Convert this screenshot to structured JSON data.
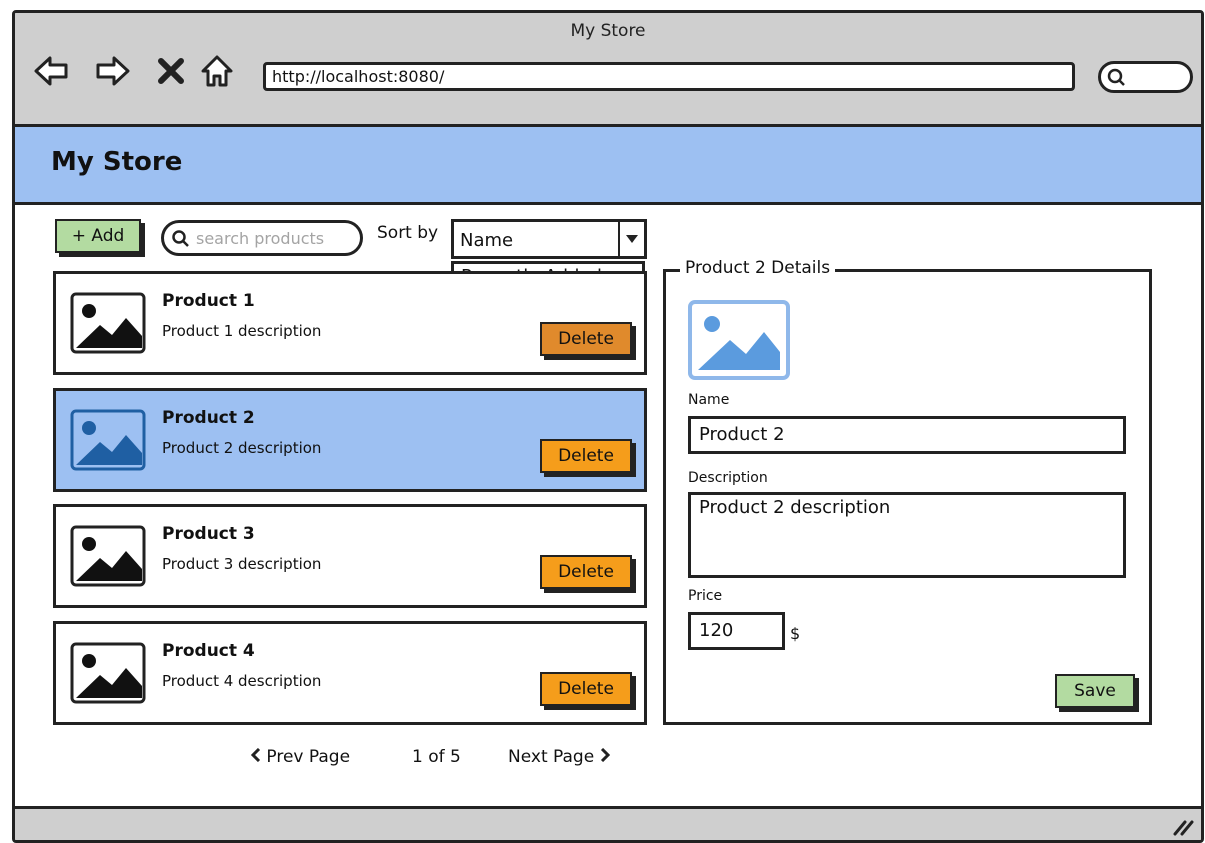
{
  "browser": {
    "title": "My Store",
    "url": "http://localhost:8080/"
  },
  "app": {
    "title": "My Store"
  },
  "toolbar": {
    "add_label": "+ Add",
    "search_placeholder": "search products",
    "sort_label": "Sort by",
    "sort_value": "Name",
    "sort_option": "Recently Added"
  },
  "products": [
    {
      "name": "Product 1",
      "description": "Product 1 description",
      "delete_label": "Delete"
    },
    {
      "name": "Product 2",
      "description": "Product 2 description",
      "delete_label": "Delete"
    },
    {
      "name": "Product 3",
      "description": "Product 3 description",
      "delete_label": "Delete"
    },
    {
      "name": "Product 4",
      "description": "Product 4 description",
      "delete_label": "Delete"
    }
  ],
  "pagination": {
    "prev_label": "Prev Page",
    "page_info": "1 of 5",
    "next_label": "Next Page"
  },
  "details": {
    "legend": "Product 2 Details",
    "name_label": "Name",
    "name_value": "Product 2",
    "description_label": "Description",
    "description_value": "Product 2 description",
    "price_label": "Price",
    "price_value": "120",
    "price_unit": "$",
    "save_label": "Save"
  },
  "colors": {
    "header": "#9dc0f2",
    "selected": "#9dc0f2",
    "add_button": "#b3dba1",
    "delete_button": "#f59d1b",
    "chrome": "#cfcfcf"
  },
  "icons": [
    "back-arrow-icon",
    "forward-arrow-icon",
    "stop-icon",
    "home-icon",
    "search-icon",
    "image-icon",
    "dropdown-arrow-icon",
    "chevron-left-icon",
    "chevron-right-icon",
    "resize-grip-icon"
  ]
}
